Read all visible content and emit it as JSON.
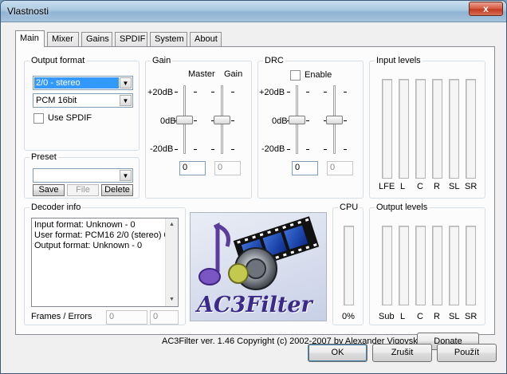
{
  "window": {
    "title": "Vlastnosti",
    "close_glyph": "x"
  },
  "tabs": [
    {
      "label": "Main",
      "active": true
    },
    {
      "label": "Mixer"
    },
    {
      "label": "Gains"
    },
    {
      "label": "SPDIF"
    },
    {
      "label": "System"
    },
    {
      "label": "About"
    }
  ],
  "output_format": {
    "legend": "Output format",
    "format_value": "2/0 - stereo",
    "pcm_value": "PCM 16bit",
    "use_spdif_label": "Use SPDIF"
  },
  "preset": {
    "legend": "Preset",
    "value": "",
    "save_label": "Save",
    "file_label": "File",
    "delete_label": "Delete"
  },
  "gain": {
    "legend": "Gain",
    "master_label": "Master",
    "gain_label": "Gain",
    "scale": [
      "+20dB",
      "0dB",
      "-20dB"
    ],
    "master_value": "0",
    "gain_value": "0"
  },
  "drc": {
    "legend": "DRC",
    "enable_label": "Enable",
    "scale": [
      "+20dB",
      "0dB",
      "-20dB"
    ],
    "value1": "0",
    "value2": "0"
  },
  "input_levels": {
    "legend": "Input levels",
    "channels": [
      "LFE",
      "L",
      "C",
      "R",
      "SL",
      "SR"
    ]
  },
  "decoder_info": {
    "legend": "Decoder info",
    "lines": [
      "Input format: Unknown - 0",
      "User format: PCM16 2/0 (stereo) 0",
      "Output format: Unknown - 0"
    ],
    "frames_errors_label": "Frames / Errors",
    "frames_value": "0",
    "errors_value": "0"
  },
  "logo": {
    "text": "AC3Filter"
  },
  "cpu": {
    "legend": "CPU",
    "value": "0%"
  },
  "output_levels": {
    "legend": "Output levels",
    "channels": [
      "Sub",
      "L",
      "C",
      "R",
      "SL",
      "SR"
    ]
  },
  "footer": {
    "copyright": "AC3Filter ver. 1.46 Copyright (c) 2002-2007 by Alexander Vigovsky",
    "donate_label": "Donate"
  },
  "dialog_buttons": {
    "ok": "OK",
    "cancel": "Zrušit",
    "apply": "Použít"
  }
}
